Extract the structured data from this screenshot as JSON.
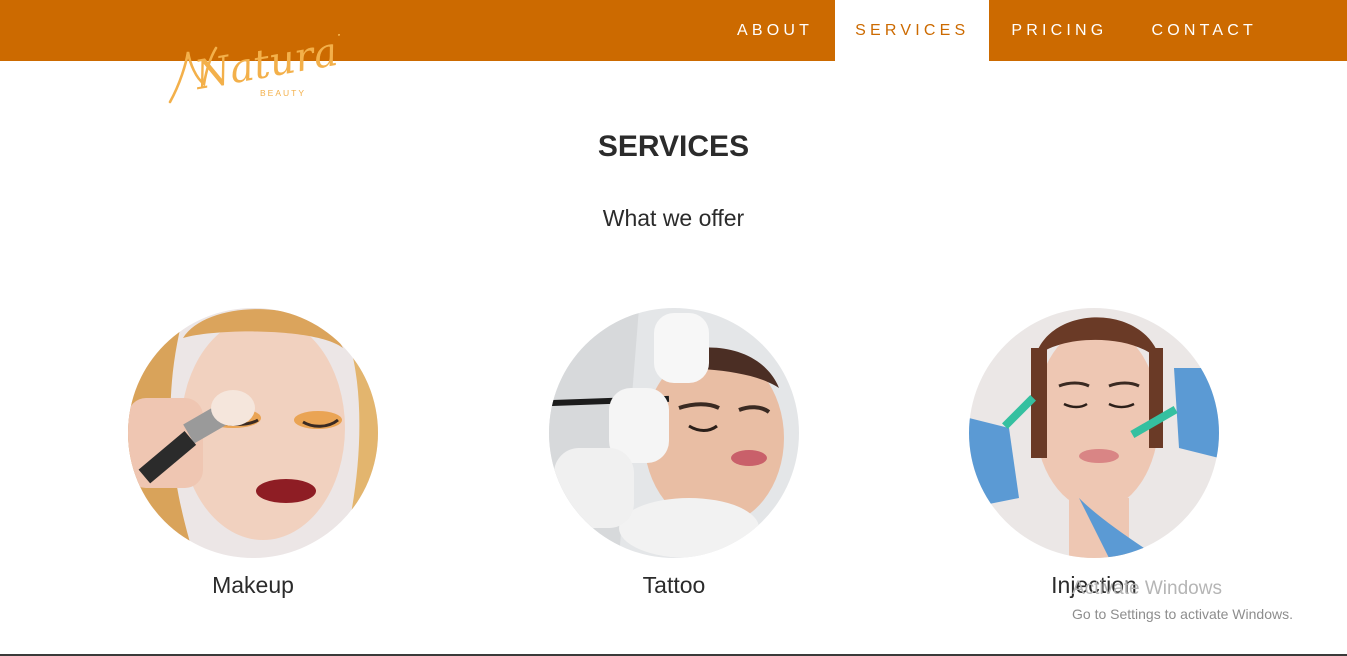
{
  "brand": {
    "logo_text": "Natural",
    "logo_subtext": "BEAUTY",
    "accent_color": "#cc6a00",
    "logo_color": "#f3b04a"
  },
  "nav": {
    "items": [
      {
        "label": "ABOUT",
        "active": false
      },
      {
        "label": "SERVICES",
        "active": true
      },
      {
        "label": "PRICING",
        "active": false
      },
      {
        "label": "CONTACT",
        "active": false
      }
    ]
  },
  "main": {
    "title": "SERVICES",
    "subtitle": "What we offer",
    "services": [
      {
        "label": "Makeup",
        "icon": "makeup-photo"
      },
      {
        "label": "Tattoo",
        "icon": "tattoo-photo"
      },
      {
        "label": "Injection",
        "icon": "injection-photo"
      }
    ]
  },
  "os_watermark": {
    "title": "Activate Windows",
    "subtitle": "Go to Settings to activate Windows."
  }
}
